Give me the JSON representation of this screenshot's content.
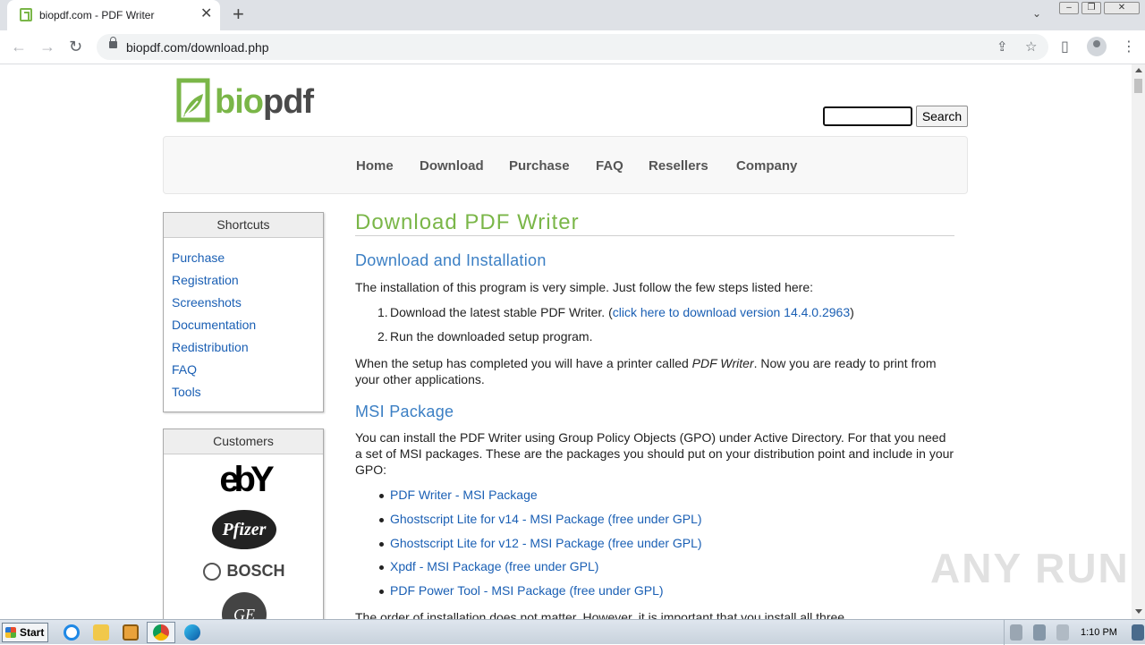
{
  "browser": {
    "tab_title": "biopdf.com - PDF Writer",
    "tab_close": "✕",
    "new_tab": "+",
    "tab_menu": "⌄",
    "url": "biopdf.com/download.php",
    "back": "←",
    "forward": "→",
    "reload": "↻",
    "share": "⇪",
    "bookmark": "☆",
    "sidepanel": "▯",
    "menu": "⋮",
    "win_minimize": "–",
    "win_restore": "❐",
    "win_close": "✕"
  },
  "site": {
    "logo_bio": "bio",
    "logo_pdf": "pdf",
    "search_button": "Search",
    "nav": [
      "Home",
      "Download",
      "Purchase",
      "FAQ",
      "Resellers",
      "Company"
    ],
    "shortcuts_title": "Shortcuts",
    "shortcuts": [
      "Purchase",
      "Registration",
      "Screenshots",
      "Documentation",
      "Redistribution",
      "FAQ",
      "Tools"
    ],
    "customers_title": "Customers",
    "customers": [
      "ebY",
      "Pfizer",
      "BOSCH",
      "GE"
    ]
  },
  "content": {
    "title": "Download PDF Writer",
    "section1_title": "Download and Installation",
    "section1_intro": "The installation of this program is very simple. Just follow the few steps listed here:",
    "step1_num": "1.",
    "step1_text": "Download the latest stable PDF Writer. (",
    "step1_link": "click here to download version 14.4.0.2963",
    "step1_close": ")",
    "step2_num": "2.",
    "step2_text": "Run the downloaded setup program.",
    "after_setup_a": "When the setup has completed you will have a printer called ",
    "after_setup_em": "PDF Writer",
    "after_setup_b": ". Now you are ready to print from your other applications.",
    "section2_title": "MSI Package",
    "section2_intro": "You can install the PDF Writer using Group Policy Objects (GPO) under Active Directory. For that you need a set of MSI packages. These are the packages you should put on your distribution point and include in your GPO:",
    "msi_links": [
      "PDF Writer - MSI Package",
      "Ghostscript Lite for v14 - MSI Package (free under GPL)",
      "Ghostscript Lite for v12 - MSI Package (free under GPL)",
      "Xpdf - MSI Package (free under GPL)",
      "PDF Power Tool - MSI Package (free under GPL)"
    ],
    "order_note": "The order of installation does not matter. However, it is important that you install all three"
  },
  "watermark": "ANY RUN",
  "taskbar": {
    "start": "Start",
    "clock": "1:10 PM"
  },
  "colors": {
    "brand_green": "#7ab648",
    "link_blue": "#1a5fb4",
    "heading_blue": "#3b7fc4"
  }
}
